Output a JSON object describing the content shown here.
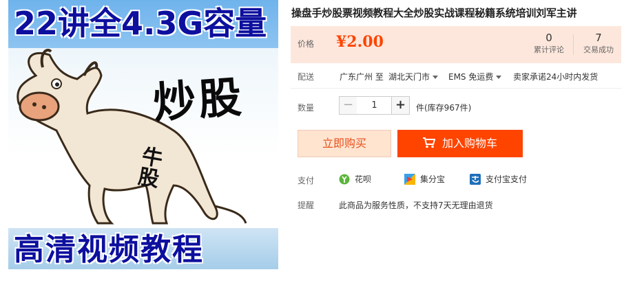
{
  "product_image": {
    "top_text": "22讲全4.3G容量",
    "side_text": "炒股",
    "badge_text": "牛股",
    "bottom_text": "高清视频教程"
  },
  "title": "操盘手炒股票视频教程大全炒股实战课程秘籍系统培训刘军主讲",
  "price": {
    "label": "价格",
    "value": "¥2.00",
    "reviews_count": "0",
    "reviews_label": "累计评论",
    "deals_count": "7",
    "deals_label": "交易成功"
  },
  "shipping": {
    "label": "配送",
    "from": "广东广州 至",
    "to": "湖北天门市",
    "method": "EMS 免运费",
    "promise": "卖家承诺24小时内发货"
  },
  "quantity": {
    "label": "数量",
    "value": "1",
    "minus": "−",
    "plus": "+",
    "stock": "件(库存967件)"
  },
  "actions": {
    "buy_now": "立即购买",
    "add_to_cart": "加入购物车"
  },
  "payment": {
    "label": "支付",
    "options": [
      "花呗",
      "集分宝",
      "支付宝支付"
    ]
  },
  "notice": {
    "label": "提醒",
    "text": "此商品为服务性质，不支持7天无理由退货"
  },
  "colors": {
    "accent": "#ff4400",
    "price": "#ff4400",
    "price_bg": "#fde7dc"
  }
}
